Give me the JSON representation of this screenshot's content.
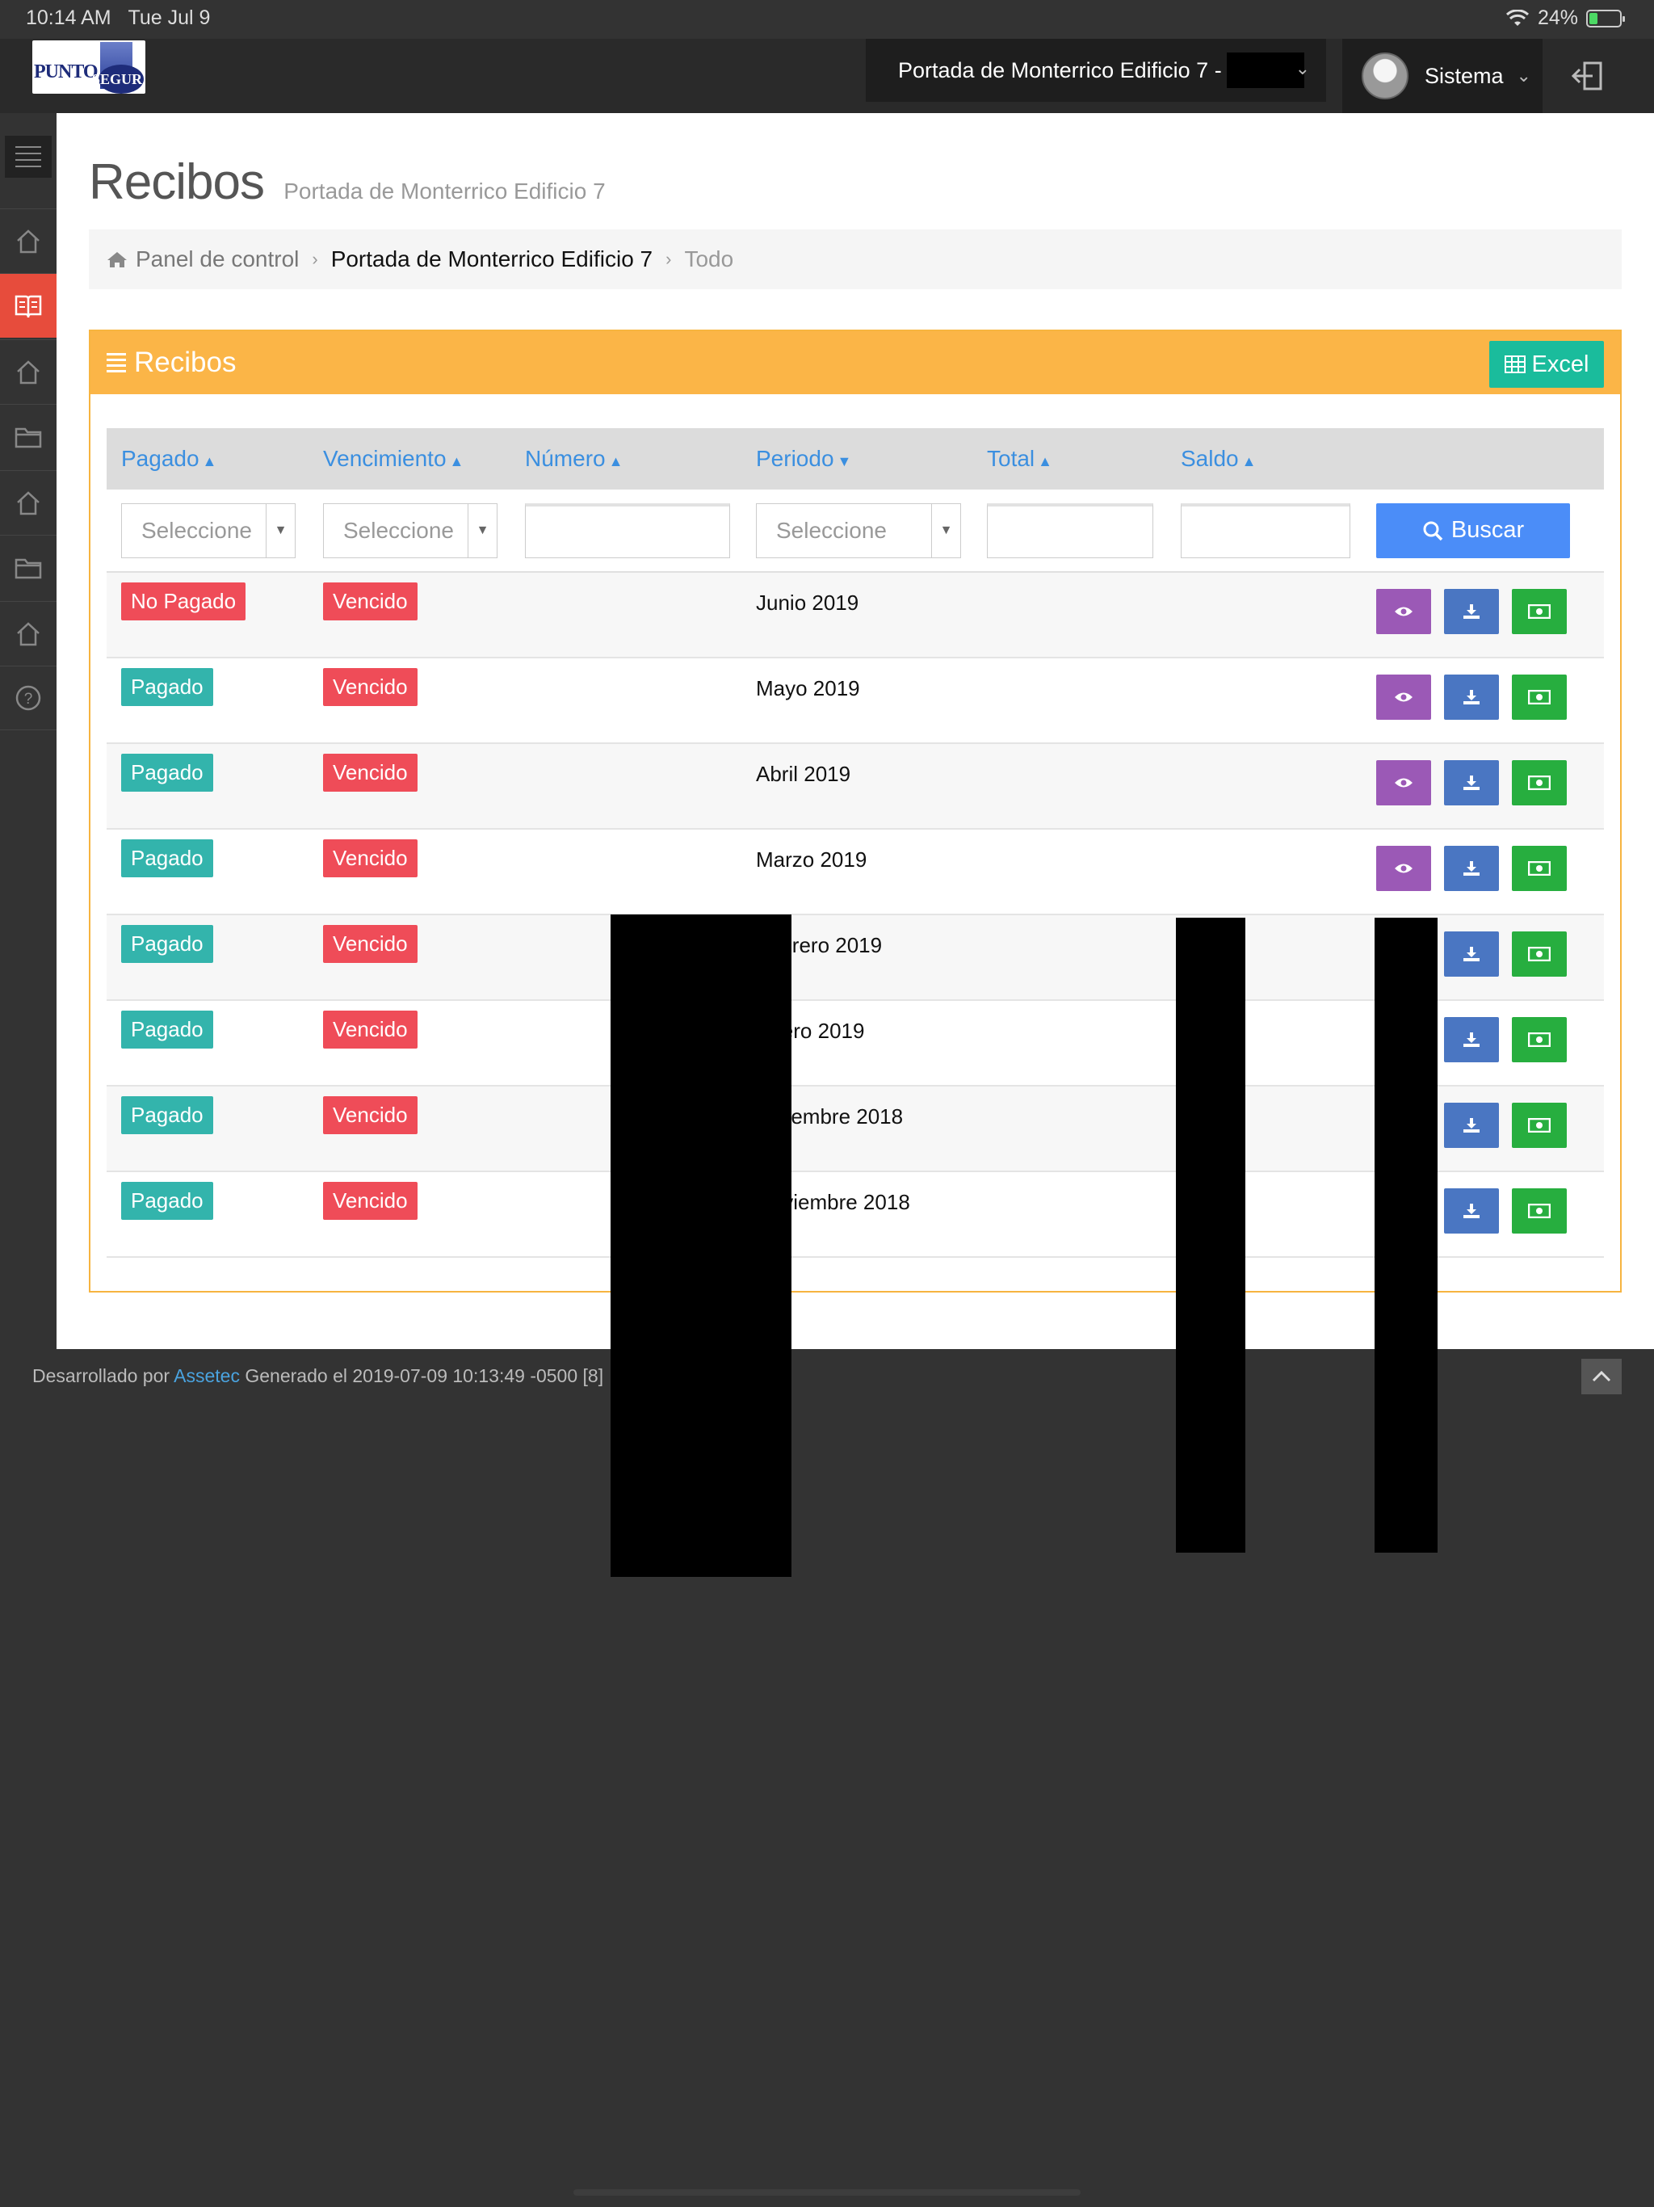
{
  "status_bar": {
    "time": "10:14 AM",
    "date": "Tue Jul 9",
    "battery": "24%"
  },
  "header": {
    "logo_text": "PUNTO",
    "logo_text2": "SEGUR",
    "condo": "Portada de Monterrico Edificio 7 -",
    "user": "Sistema"
  },
  "sidebar": {
    "icons": [
      "home-icon",
      "book-icon",
      "home-icon",
      "folder-icon",
      "home-icon",
      "folder-icon",
      "home-icon",
      "help-icon"
    ],
    "active_index": 1
  },
  "page": {
    "title": "Recibos",
    "subtitle": "Portada de Monterrico Edificio 7"
  },
  "breadcrumb": {
    "home": "Panel de control",
    "current": "Portada de Monterrico Edificio 7",
    "last": "Todo"
  },
  "panel": {
    "title": "Recibos",
    "excel_label": "Excel"
  },
  "table": {
    "headers": {
      "pagado": "Pagado",
      "vencimiento": "Vencimiento",
      "numero": "Número",
      "periodo": "Periodo",
      "total": "Total",
      "saldo": "Saldo"
    },
    "filters": {
      "pagado": "Seleccione",
      "vencimiento": "Seleccione",
      "periodo": "Seleccione",
      "search_label": "Buscar"
    },
    "rows": [
      {
        "pagado": "No Pagado",
        "vencimiento": "Vencido",
        "periodo": "Junio 2019"
      },
      {
        "pagado": "Pagado",
        "vencimiento": "Vencido",
        "periodo": "Mayo 2019"
      },
      {
        "pagado": "Pagado",
        "vencimiento": "Vencido",
        "periodo": "Abril 2019"
      },
      {
        "pagado": "Pagado",
        "vencimiento": "Vencido",
        "periodo": "Marzo 2019"
      },
      {
        "pagado": "Pagado",
        "vencimiento": "Vencido",
        "periodo": "Febrero 2019"
      },
      {
        "pagado": "Pagado",
        "vencimiento": "Vencido",
        "periodo": "Enero 2019"
      },
      {
        "pagado": "Pagado",
        "vencimiento": "Vencido",
        "periodo": "Diciembre 2018"
      },
      {
        "pagado": "Pagado",
        "vencimiento": "Vencido",
        "periodo": "Noviembre 2018"
      }
    ]
  },
  "footer": {
    "prefix": "Desarrollado por",
    "link": "Assetec",
    "generated": "Generado el 2019-07-09 10:13:49 -0500 [8]"
  },
  "colors": {
    "panel_header": "#fbb547",
    "active_sidebar": "#e74c3c",
    "badge_unpaid": "#ef4c58",
    "badge_paid": "#33b4ac",
    "view_button": "#9b59b6",
    "download_button": "#4a76c2",
    "pay_button": "#27ae3f",
    "search_button": "#4b8df8",
    "excel_button": "#1abc9c"
  }
}
